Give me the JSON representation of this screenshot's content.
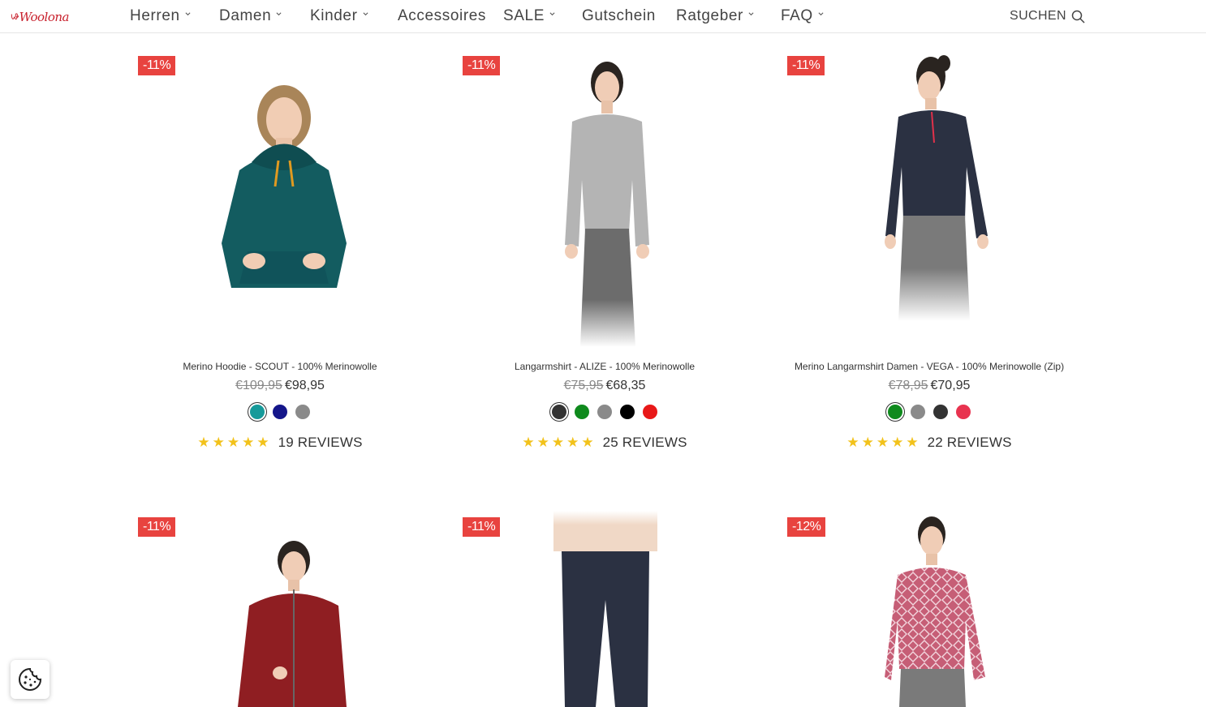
{
  "header": {
    "logo_text": "Woolona",
    "nav": [
      {
        "label": "Herren",
        "has_menu": true
      },
      {
        "label": "Damen",
        "has_menu": true
      },
      {
        "label": "Kinder",
        "has_menu": true
      },
      {
        "label": "Accessoires",
        "has_menu": false
      },
      {
        "label": "SALE",
        "has_menu": true
      },
      {
        "label": "Gutschein",
        "has_menu": false
      },
      {
        "label": "Ratgeber",
        "has_menu": true
      },
      {
        "label": "FAQ",
        "has_menu": true
      }
    ],
    "search_label": "SUCHEN"
  },
  "products": [
    {
      "badge": "-11%",
      "title": "Merino Hoodie - SCOUT - 100% Merinowolle",
      "old_price": "€109,95",
      "price": "€98,95",
      "swatches": [
        "#169a9a",
        "#14168a",
        "#8a8a8a"
      ],
      "selected_swatch": 0,
      "reviews": "19 REVIEWS",
      "rating": 5
    },
    {
      "badge": "-11%",
      "title": "Langarmshirt - ALIZE - 100% Merinowolle",
      "old_price": "€75,95",
      "price": "€68,35",
      "swatches": [
        "#333333",
        "#0f8a1d",
        "#8a8a8a",
        "#000000",
        "#e81818"
      ],
      "selected_swatch": 0,
      "reviews": "25 REVIEWS",
      "rating": 5
    },
    {
      "badge": "-11%",
      "title": "Merino Langarmshirt Damen - VEGA - 100% Merinowolle (Zip)",
      "old_price": "€78,95",
      "price": "€70,95",
      "swatches": [
        "#0f8a1d",
        "#8a8a8a",
        "#333333",
        "#e8334f"
      ],
      "selected_swatch": 0,
      "reviews": "22 REVIEWS",
      "rating": 5
    },
    {
      "badge": "-11%"
    },
    {
      "badge": "-11%"
    },
    {
      "badge": "-12%"
    }
  ],
  "colors": {
    "badge": "#e8433f",
    "stars": "#f2c21b",
    "logo": "#c8202c"
  },
  "cookie_icon": "cookie-icon"
}
